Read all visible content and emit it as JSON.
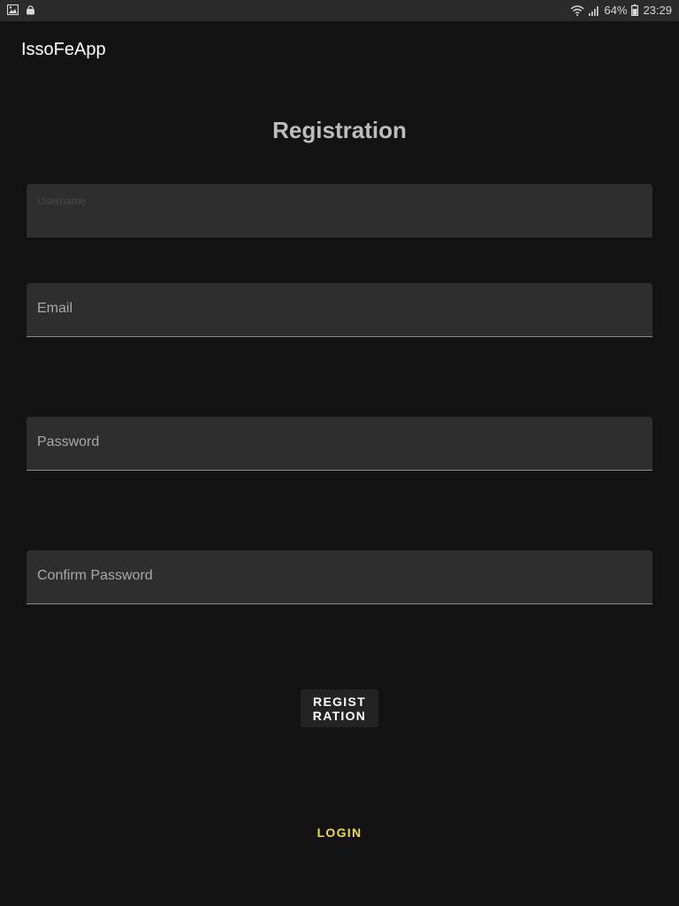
{
  "status_bar": {
    "battery": "64%",
    "time": "23:29",
    "left_icons": [
      "image-icon",
      "shopping-bag-icon"
    ],
    "right_icons": [
      "wifi-icon",
      "signal-icon",
      "battery-icon"
    ]
  },
  "app": {
    "title": "IssoFeApp"
  },
  "form": {
    "title": "Registration",
    "username_label": "Username",
    "email_placeholder": "Email",
    "password_placeholder": "Password",
    "confirm_password_placeholder": "Confirm Password",
    "register_button": "REGIST RATION",
    "login_link": "LOGIN"
  },
  "colors": {
    "background": "#131313",
    "field_background": "#2e2e2e",
    "accent": "#f2d94a"
  }
}
